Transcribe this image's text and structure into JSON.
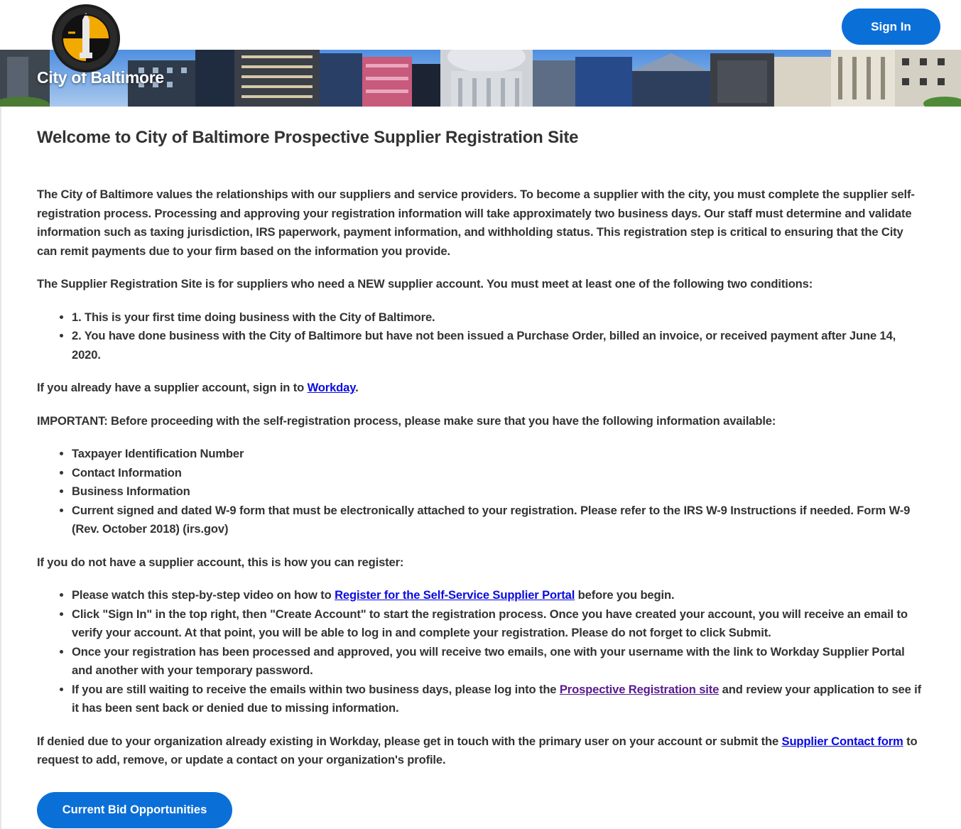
{
  "header": {
    "sign_in_label": "Sign In",
    "banner_title": "City of Baltimore",
    "seal_text": "CITY OF BALTIMORE",
    "accent_color": "#0b6fd8"
  },
  "main": {
    "title": "Welcome to City of Baltimore Prospective Supplier Registration Site",
    "intro": "The City of Baltimore values the relationships with our suppliers and service providers. To become a supplier with the city, you must complete the supplier self-registration process. Processing and approving your registration information will take approximately two business days. Our staff must determine and validate information such as taxing jurisdiction, IRS paperwork, payment information, and withholding status. This registration step is critical to ensuring that the  City can remit payments due to your firm based on the information you provide.",
    "conditions_intro": "The Supplier Registration Site is for suppliers who need a NEW supplier account. You must meet at least one of the following two conditions:",
    "conditions": [
      "1. This is your first time doing business with the City of Baltimore.",
      "2. You have done business with the City of Baltimore but have not been issued a Purchase Order, billed an invoice, or received payment after June 14, 2020."
    ],
    "existing_account": {
      "before": "If you already have a supplier account, sign in to ",
      "link": "Workday",
      "after": "."
    },
    "important": "IMPORTANT: Before proceeding with the self-registration process, please make sure that you have the following information available:",
    "required_info": [
      "Taxpayer Identification Number",
      "Contact Information",
      "Business Information",
      "Current signed and dated W-9 form that must be electronically attached to your registration. Please refer to the IRS W-9 Instructions if needed. Form W-9 (Rev. October 2018) (irs.gov)"
    ],
    "register_intro": "If you do not have a supplier account, this is how you can register:",
    "register_steps": {
      "step1_before": "Please watch this step-by-step video on how to ",
      "step1_link": "Register for the Self-Service Supplier Portal",
      "step1_after": " before you begin.",
      "step2": "Click \"Sign In\" in the top right, then \"Create Account\" to start the registration process. Once you have created your account, you will receive an email to verify your account. At that point, you will be able to log in and complete your registration. Please do not forget to click Submit.",
      "step3": "Once your registration has been processed and approved, you will receive two emails, one with your username with the link to Workday Supplier Portal and another with your temporary password.",
      "step4_before": "If you are still waiting to receive the emails within two business days, please log into the ",
      "step4_link": "Prospective Registration site",
      "step4_after": " and review your application to see if it has been sent back or denied due to missing information."
    },
    "denied": {
      "before": "If denied due to your organization already existing in Workday, please get in touch with the primary user on your account or submit the ",
      "link": "Supplier Contact form",
      "after": " to request to add, remove, or update a contact on your organization's profile."
    },
    "bid_button_label": "Current Bid Opportunities"
  },
  "colors": {
    "link": "#0a0ae0",
    "visited_link": "#5a1a8f",
    "text": "#333333"
  }
}
